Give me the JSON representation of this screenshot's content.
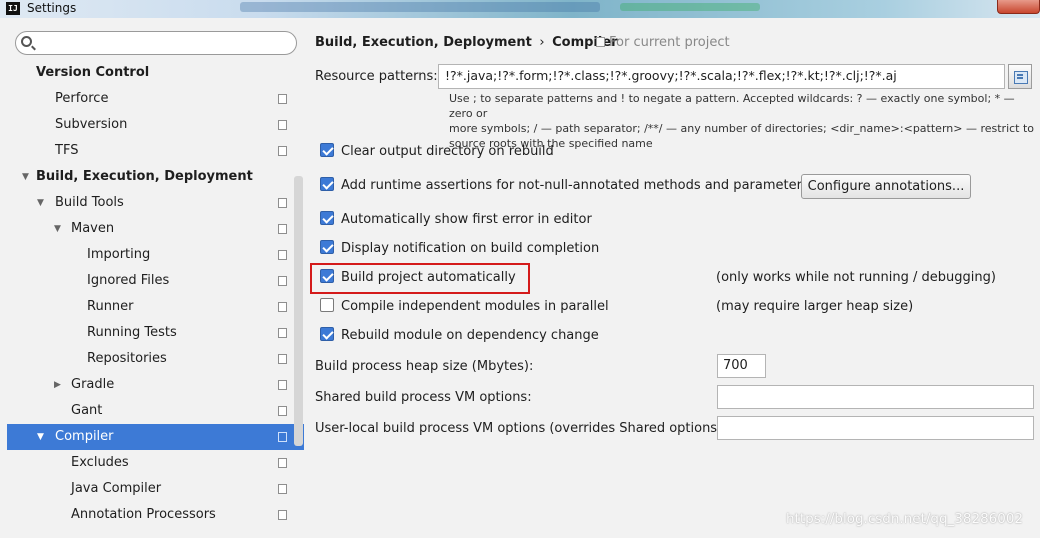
{
  "window": {
    "title": "Settings",
    "app_icon_text": "IJ"
  },
  "sidebar": {
    "items": [
      {
        "label": "Version Control",
        "bold": true,
        "arrow": "",
        "level": 0
      },
      {
        "label": "Perforce",
        "level": 1,
        "arrow": ""
      },
      {
        "label": "Subversion",
        "level": 1,
        "arrow": ""
      },
      {
        "label": "TFS",
        "level": 1,
        "arrow": ""
      },
      {
        "label": "Build, Execution, Deployment",
        "bold": true,
        "arrow": "down",
        "level": 0
      },
      {
        "label": "Build Tools",
        "level": 1,
        "arrow": "down"
      },
      {
        "label": "Maven",
        "level": 2,
        "arrow": "down"
      },
      {
        "label": "Importing",
        "level": 3,
        "arrow": ""
      },
      {
        "label": "Ignored Files",
        "level": 3,
        "arrow": ""
      },
      {
        "label": "Runner",
        "level": 3,
        "arrow": ""
      },
      {
        "label": "Running Tests",
        "level": 3,
        "arrow": ""
      },
      {
        "label": "Repositories",
        "level": 3,
        "arrow": ""
      },
      {
        "label": "Gradle",
        "level": 2,
        "arrow": "right"
      },
      {
        "label": "Gant",
        "level": 2,
        "arrow": ""
      },
      {
        "label": "Compiler",
        "level": 1,
        "arrow": "down",
        "selected": true
      },
      {
        "label": "Excludes",
        "level": 2,
        "arrow": ""
      },
      {
        "label": "Java Compiler",
        "level": 2,
        "arrow": ""
      },
      {
        "label": "Annotation Processors",
        "level": 2,
        "arrow": ""
      }
    ]
  },
  "header": {
    "breadcrumb_parent": "Build, Execution, Deployment",
    "breadcrumb_sep": "›",
    "breadcrumb_current": "Compiler",
    "scope": "For current project"
  },
  "resource": {
    "label": "Resource patterns:",
    "value": "!?*.java;!?*.form;!?*.class;!?*.groovy;!?*.scala;!?*.flex;!?*.kt;!?*.clj;!?*.aj",
    "hint_line1": "Use ; to separate patterns and ! to negate a pattern. Accepted wildcards: ? — exactly one symbol; * — zero or",
    "hint_line2": "more symbols; / — path separator; /**/ — any number of directories; <dir_name>:<pattern> — restrict to",
    "hint_line3": "source roots with the specified name"
  },
  "options": [
    {
      "label": "Clear output directory on rebuild",
      "checked": true
    },
    {
      "label": "Add runtime assertions for not-null-annotated methods and parameters",
      "checked": true
    },
    {
      "label": "Automatically show first error in editor",
      "checked": true
    },
    {
      "label": "Display notification on build completion",
      "checked": true
    },
    {
      "label": "Build project automatically",
      "checked": true
    },
    {
      "label": "Compile independent modules in parallel",
      "checked": false
    },
    {
      "label": "Rebuild module on dependency change",
      "checked": true
    }
  ],
  "notes": {
    "auto_build": "(only works while not running / debugging)",
    "parallel": "(may require larger heap size)"
  },
  "configure_button": "Configure annotations...",
  "fields": {
    "heap_label": "Build process heap size (Mbytes):",
    "heap_value": "700",
    "shared_vm_label": "Shared build process VM options:",
    "shared_vm_value": "",
    "user_vm_label": "User-local build process VM options (overrides Shared options):",
    "user_vm_value": ""
  },
  "watermark": "https://blog.csdn.net/qq_38286002",
  "colors": {
    "selection": "#3d7ad6",
    "highlight_box": "#d41a1a",
    "background": "#f2f2f2"
  }
}
